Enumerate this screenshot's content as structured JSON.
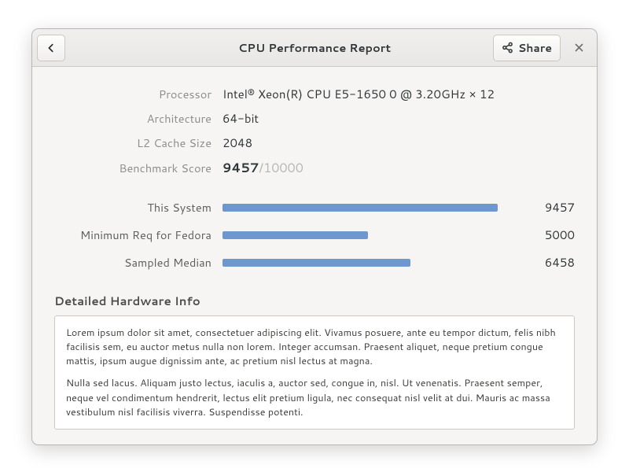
{
  "titlebar": {
    "title": "CPU Performance Report",
    "share_label": "Share"
  },
  "props": {
    "processor_label": "Processor",
    "processor_value": "Intel® Xeon(R) CPU E5-1650 0 @ 3.20GHz × 12",
    "arch_label": "Architecture",
    "arch_value": "64-bit",
    "l2_label": "L2 Cache Size",
    "l2_value": "2048",
    "score_label": "Benchmark Score",
    "score_value": "9457",
    "score_max": "/10000"
  },
  "bars": {
    "max": 10000,
    "items": [
      {
        "label": "This System",
        "value": 9457
      },
      {
        "label": "Minimum Req for Fedora",
        "value": 5000
      },
      {
        "label": "Sampled Median",
        "value": 6458
      }
    ]
  },
  "detail": {
    "heading": "Detailed Hardware Info",
    "paragraphs": [
      "Lorem ipsum dolor sit amet, consectetuer adipiscing elit. Vivamus posuere, ante eu tempor dictum, felis nibh facilisis sem, eu auctor metus nulla non lorem. Integer accumsan. Praesent aliquet, neque pretium congue mattis, ipsum augue dignissim ante, ac pretium nisl lectus at magna.",
      "Nulla sed lacus. Aliquam justo lectus, iaculis a, auctor sed, congue in, nisl. Ut venenatis. Praesent semper, neque vel condimentum hendrerit, lectus elit pretium ligula, nec consequat nisl velit at dui. Mauris ac massa vestibulum nisl facilisis viverra. Suspendisse potenti."
    ]
  }
}
